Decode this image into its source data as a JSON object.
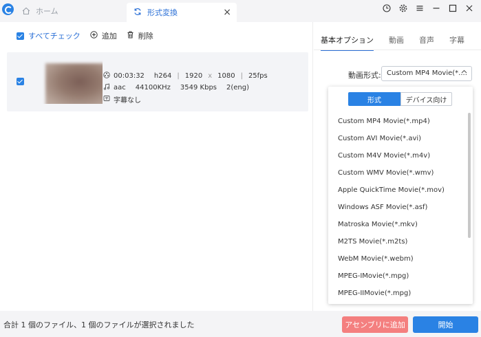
{
  "titlebar": {
    "logo_icon": "app-logo-icon",
    "home_tab_label": "ホーム",
    "convert_tab_label": "形式変換",
    "close_glyph": "×",
    "controls": [
      "history-icon",
      "gear-icon",
      "menu-icon",
      "minimize-icon",
      "maximize-icon",
      "close-icon"
    ]
  },
  "toolbar": {
    "select_all_label": "すべてチェック",
    "add_label": "追加",
    "delete_label": "削除"
  },
  "file": {
    "duration": "00:03:32",
    "video_codec": "h264",
    "width": "1920",
    "x": "x",
    "height": "1080",
    "fps": "25fps",
    "audio_codec": "aac",
    "sample_rate": "44100KHz",
    "bitrate": "3549 Kbps",
    "channels": "2(eng)",
    "subtitle": "字幕なし"
  },
  "options": {
    "tabs": [
      "基本オプション",
      "動画",
      "音声",
      "字幕"
    ],
    "active_tab_index": 0,
    "format_label": "動画形式:",
    "format_value": "Custom MP4 Movie(*...."
  },
  "dropdown": {
    "seg_format": "形式",
    "seg_device": "デバイス向け",
    "items": [
      "Custom MP4 Movie(*.mp4)",
      "Custom AVI Movie(*.avi)",
      "Custom M4V Movie(*.m4v)",
      "Custom WMV Movie(*.wmv)",
      "Apple QuickTime Movie(*.mov)",
      "Windows ASF Movie(*.asf)",
      "Matroska Movie(*.mkv)",
      "M2TS Movie(*.m2ts)",
      "WebM Movie(*.webm)",
      "MPEG-IMovie(*.mpg)",
      "MPEG-IIMovie(*.mpg)"
    ]
  },
  "statusbar": {
    "status_text": "合計 1 個のファイル、1 個のファイルが選択されました",
    "assembly_label": "アセンブリに追加",
    "start_label": "開始"
  },
  "colors": {
    "accent": "#2a82e4",
    "assembly_button": "#f47f7f"
  }
}
